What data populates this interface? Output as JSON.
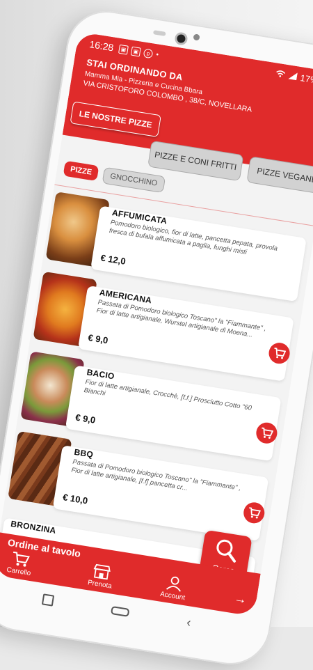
{
  "status_bar": {
    "time": "16:28",
    "battery": "17%"
  },
  "header": {
    "ordering_label": "STAI ORDINANDO DA",
    "restaurant_name": "Mamma Mia - Pizzeria e Cucina Bbara",
    "address": "VIA CRISTOFORO COLOMBO , 38/C, NOVELLARA"
  },
  "categories": [
    "LE NOSTRE PIZZE",
    "PIZZE E CONI FRITTI",
    "PIZZE VEGANE"
  ],
  "subcategories": [
    "PIZZE",
    "GNOCCHINO"
  ],
  "products": [
    {
      "name": "AFFUMICATA",
      "description": "Pomodoro biologico, fior di latte, pancetta pepata, provola fresca di bufala affumicata a paglia, funghi misti",
      "price": "€ 12,0"
    },
    {
      "name": "AMERICANA",
      "description": "Passata di Pomodoro biologico Toscano\" la \"Fiammante\" , Fior di latte artigianale, Wurstel artigianale di Moena...",
      "price": "€ 9,0"
    },
    {
      "name": "BACIO",
      "description": "Fior di latte artigianale, Crocchè, [f.f.] Prosciutto Cotto \"60 Bianchi",
      "price": "€ 9,0"
    },
    {
      "name": "BBQ",
      "description": "Passata di Pomodoro biologico Toscano\" la \"Fiammante\" , Fior di latte artigianale, [f.f] pancetta cr...",
      "price": "€ 10,0"
    },
    {
      "name": "BRONZINA",
      "description": "",
      "price": ""
    }
  ],
  "search_button": {
    "label": "Cerca"
  },
  "bottom_bar": {
    "banner": "Ordine al tavolo",
    "items": [
      "Carrello",
      "Prenota",
      "Account"
    ]
  },
  "colors": {
    "primary": "#e02b2b",
    "grey_tab": "#d2d2d2"
  }
}
